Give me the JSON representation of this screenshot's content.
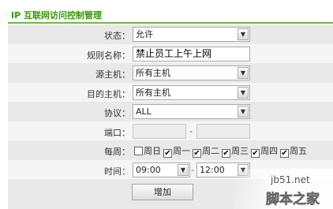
{
  "page": {
    "title": "IP 互联网访问控制管理",
    "accent_color": "#339900"
  },
  "form": {
    "status": {
      "label": "状态：",
      "value": "允许"
    },
    "rule_name": {
      "label": "规则名称：",
      "value": "禁止员工上午上网"
    },
    "source_host": {
      "label": "源主机：",
      "value": "所有主机"
    },
    "dest_host": {
      "label": "目的主机：",
      "value": "所有主机"
    },
    "protocol": {
      "label": "协议：",
      "value": "ALL"
    },
    "port": {
      "label": "端口：",
      "from": "",
      "to": "",
      "separator": "-"
    },
    "weekly": {
      "label": "每周：",
      "days": [
        {
          "name": "周日",
          "checked": false
        },
        {
          "name": "周一",
          "checked": true
        },
        {
          "name": "周二",
          "checked": true
        },
        {
          "name": "周三",
          "checked": true
        },
        {
          "name": "周四",
          "checked": true
        },
        {
          "name": "周五",
          "checked": true
        }
      ]
    },
    "time": {
      "label": "时间：",
      "start": "09:00",
      "end": "12:00",
      "separator": "-"
    },
    "add_button": "增加"
  },
  "watermark": {
    "site": "jb51.net",
    "brand": "脚本之家"
  }
}
